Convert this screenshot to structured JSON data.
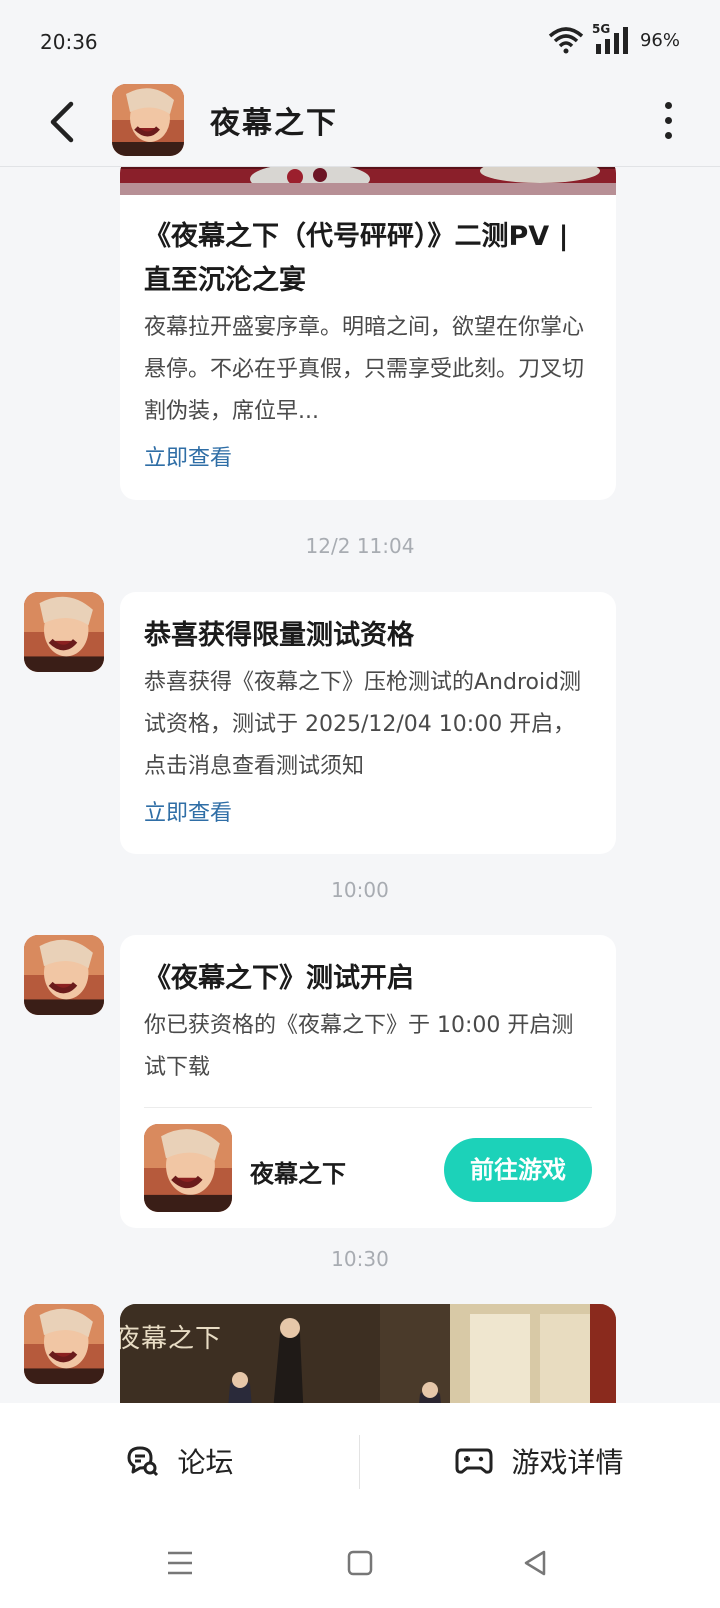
{
  "status": {
    "time": "20:36",
    "network": "5G",
    "battery": "96%"
  },
  "header": {
    "title": "夜幕之下"
  },
  "messages": [
    {
      "title": "《夜幕之下（代号砰砰）》二测PV | 直至沉沦之宴",
      "text": "夜幕拉开盛宴序章。明暗之间，欲望在你掌心悬停。不必在乎真假，只需享受此刻。刀叉切割伪装，席位早...",
      "link": "立即查看"
    },
    {
      "timestamp": "12/2  11:04",
      "title": "恭喜获得限量测试资格",
      "text": "恭喜获得《夜幕之下》压枪测试的Android测试资格，测试于 2025/12/04 10:00 开启，点击消息查看测试须知",
      "link": "立即查看"
    },
    {
      "timestamp": "10:00",
      "title": "《夜幕之下》测试开启",
      "text": "你已获资格的《夜幕之下》于 10:00 开启测试下载",
      "game_name": "夜幕之下",
      "button": "前往游戏"
    },
    {
      "timestamp": "10:30",
      "image_logo_text": "夜幕之下"
    }
  ],
  "bottom_bar": {
    "forum": "论坛",
    "game_details": "游戏详情"
  },
  "colors": {
    "accent": "#1cd2b9",
    "link": "#2f6ea6",
    "background": "#f5f6f8"
  }
}
